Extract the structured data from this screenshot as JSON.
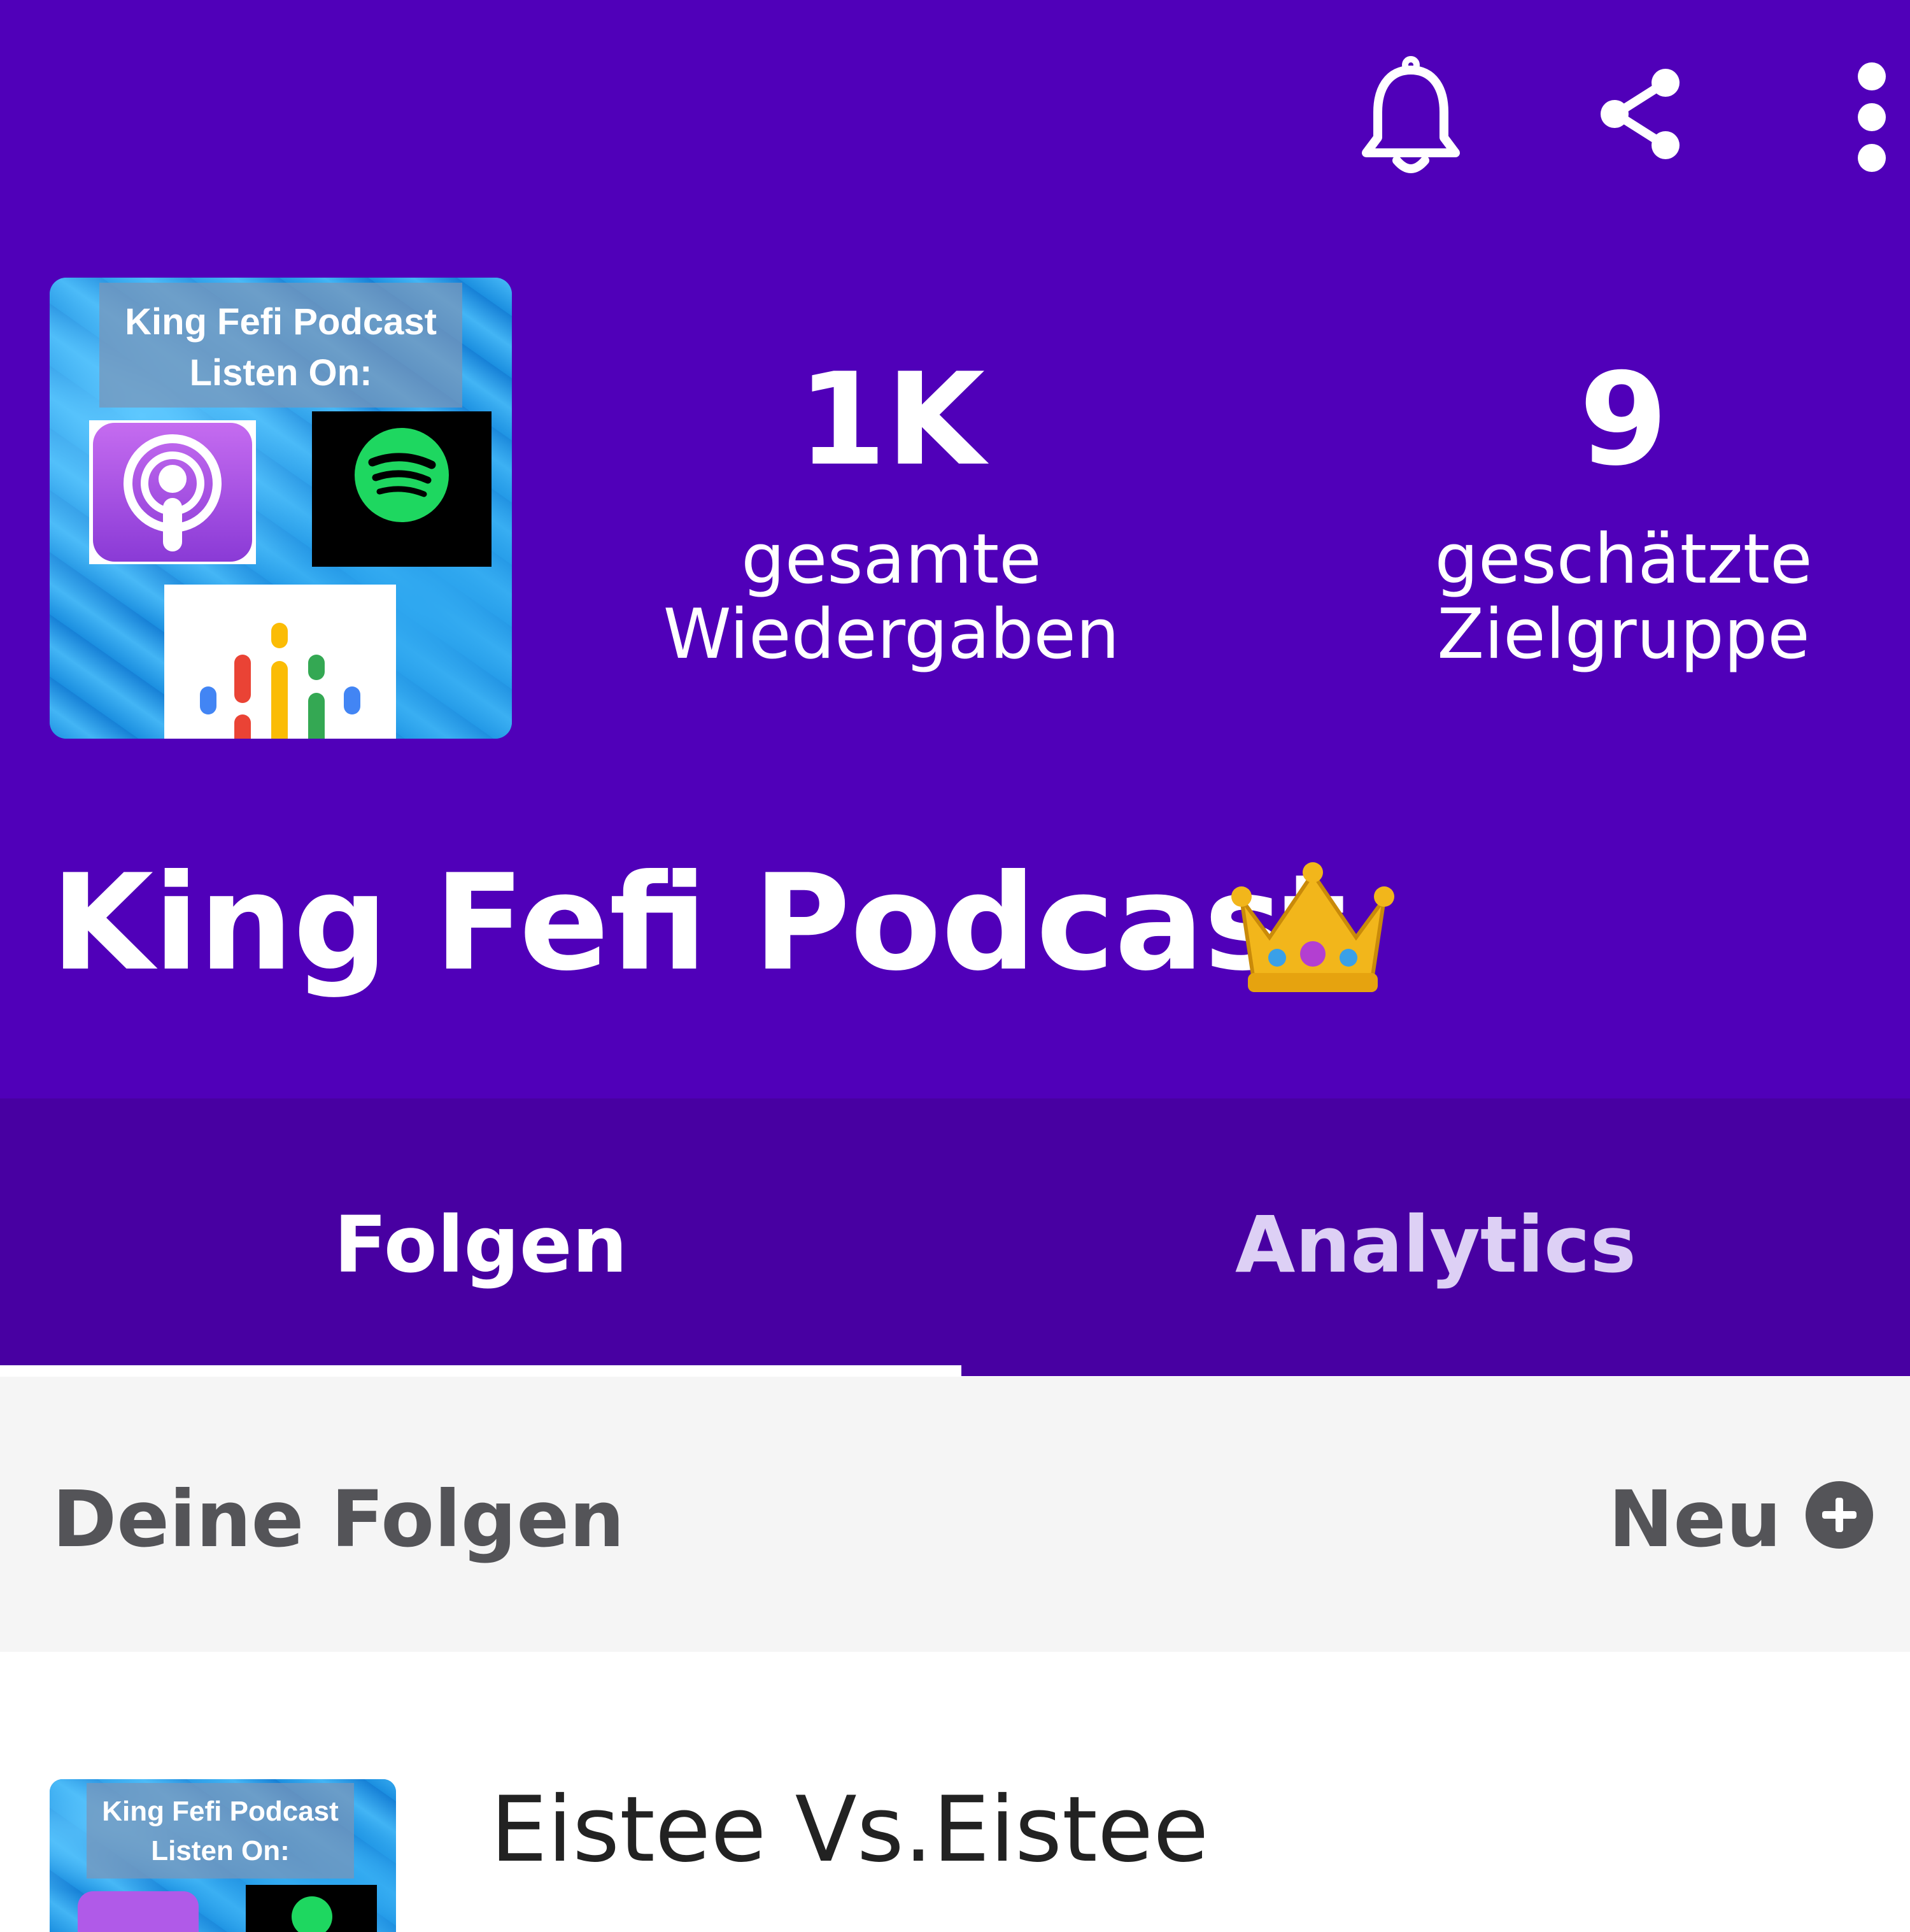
{
  "header": {
    "background_color": "#5000b9",
    "icons": [
      "bell-icon",
      "share-icon",
      "more-vert-icon"
    ],
    "cover_art": {
      "title_line1": "King Fefi Podcast",
      "title_line2": "Listen On:",
      "platform_logos": [
        "apple-podcasts-icon",
        "spotify-icon",
        "google-podcasts-icon"
      ]
    },
    "stats": [
      {
        "value": "1K",
        "label_line1": "gesamte",
        "label_line2": "Wiedergaben"
      },
      {
        "value": "9",
        "label_line1": "geschätzte",
        "label_line2": "Zielgruppe"
      }
    ],
    "podcast_title": "King Fefi Podcast",
    "title_emoji": "crown-icon"
  },
  "tabs": {
    "background_color": "#4800a2",
    "items": [
      {
        "label": "Folgen",
        "active": true
      },
      {
        "label": "Analytics",
        "active": false
      }
    ]
  },
  "section": {
    "title": "Deine Folgen",
    "new_label": "Neu",
    "new_icon": "plus-circle-icon"
  },
  "episodes": [
    {
      "title": "Eistee Vs.Eistee",
      "thumb_line1": "King Fefi Podcast",
      "thumb_line2": "Listen On:"
    }
  ]
}
